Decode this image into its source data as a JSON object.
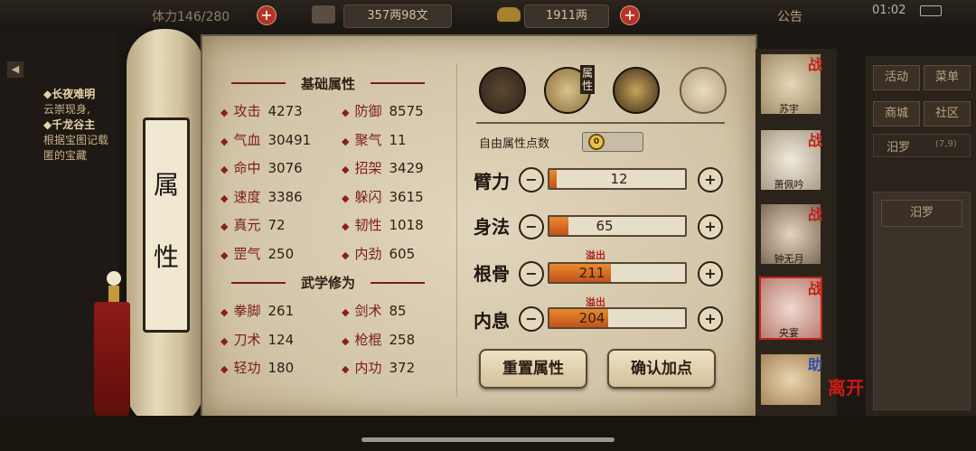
{
  "topbar": {
    "stamina": "体力146/280",
    "coins": "357两98文",
    "gold": "1911两",
    "notice": "公告",
    "time": "01:02"
  },
  "quest": {
    "item1_title": "◆长夜难明",
    "item1_desc": "云崇现身,",
    "item2_title": "◆千龙谷主",
    "item2_desc1": "根据宝图记载",
    "item2_desc2": "匿的宝藏"
  },
  "scroll": {
    "title_char1": "属",
    "title_char2": "性"
  },
  "base": {
    "title": "基础属性",
    "stats": [
      {
        "label": "攻击",
        "value": "4273"
      },
      {
        "label": "防御",
        "value": "8575"
      },
      {
        "label": "气血",
        "value": "30491"
      },
      {
        "label": "聚气",
        "value": "11"
      },
      {
        "label": "命中",
        "value": "3076"
      },
      {
        "label": "招架",
        "value": "3429"
      },
      {
        "label": "速度",
        "value": "3386"
      },
      {
        "label": "躲闪",
        "value": "3615"
      },
      {
        "label": "真元",
        "value": "72"
      },
      {
        "label": "韧性",
        "value": "1018"
      },
      {
        "label": "罡气",
        "value": "250"
      },
      {
        "label": "内劲",
        "value": "605"
      }
    ]
  },
  "martial": {
    "title": "武学修为",
    "stats": [
      {
        "label": "拳脚",
        "value": "261"
      },
      {
        "label": "剑术",
        "value": "85"
      },
      {
        "label": "刀术",
        "value": "124"
      },
      {
        "label": "枪棍",
        "value": "258"
      },
      {
        "label": "轻功",
        "value": "180"
      },
      {
        "label": "内功",
        "value": "372"
      }
    ]
  },
  "tabs": {
    "attr_tab_label": "属性"
  },
  "free_points": {
    "label": "自由属性点数",
    "value": "0"
  },
  "attributes": [
    {
      "name": "臂力",
      "value": "12",
      "fill": 0.05,
      "overflow": ""
    },
    {
      "name": "身法",
      "value": "65",
      "fill": 0.14,
      "overflow": ""
    },
    {
      "name": "根骨",
      "value": "211",
      "fill": 0.45,
      "overflow": "溢出"
    },
    {
      "name": "内息",
      "value": "204",
      "fill": 0.43,
      "overflow": "溢出"
    }
  ],
  "buttons": {
    "reset": "重置属性",
    "confirm": "确认加点"
  },
  "characters": [
    {
      "name": "苏宇",
      "tag": "战"
    },
    {
      "name": "萧佩吟",
      "tag": "战"
    },
    {
      "name": "钟无月",
      "tag": "战"
    },
    {
      "name": "央宴",
      "tag": "战"
    },
    {
      "name": "",
      "tag": "助"
    }
  ],
  "leave_label": "离开",
  "right_menu": {
    "activity": "活动",
    "menu": "菜单",
    "shop": "商城",
    "community": "社区",
    "location": "汨罗",
    "coords": "(7,9)",
    "location2": "汨罗"
  },
  "colors": {
    "accent_red": "#b3342b",
    "bar_fill": "#d9692a",
    "paper": "#d8cbb0"
  }
}
